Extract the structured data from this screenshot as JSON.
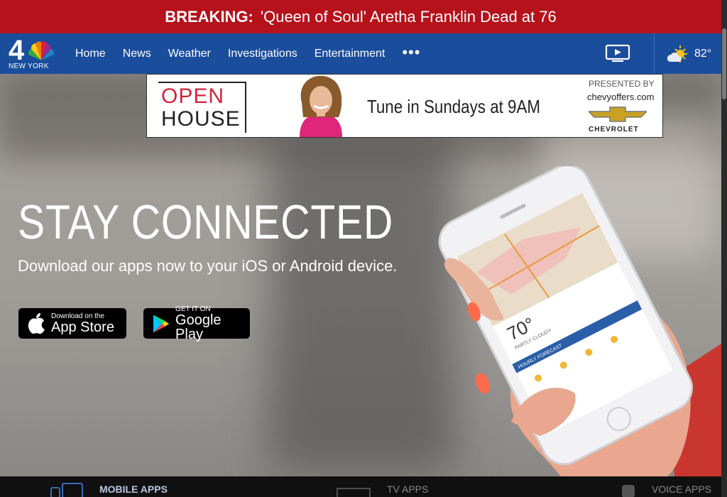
{
  "breaking": {
    "label": "BREAKING:",
    "text": "'Queen of Soul' Aretha Franklin Dead at 76"
  },
  "logo": {
    "channel": "4",
    "city": "NEW YORK"
  },
  "nav": {
    "items": [
      "Home",
      "News",
      "Weather",
      "Investigations",
      "Entertainment"
    ],
    "more": "•••"
  },
  "weather": {
    "temp": "82°"
  },
  "ad": {
    "open": "OPEN",
    "house": "HOUSE",
    "tagline": "Tune in Sundays at 9AM",
    "presented": "PRESENTED BY",
    "sponsor_site": "chevyoffers.com",
    "sponsor": "CHEVROLET"
  },
  "hero": {
    "title": "STAY CONNECTED",
    "subtitle": "Download our apps now to your iOS or Android device."
  },
  "stores": {
    "apple_small": "Download on the",
    "apple_big": "App Store",
    "google_small": "GET IT ON",
    "google_big": "Google Play"
  },
  "phone": {
    "temp": "70°",
    "condition": "PARTLY CLOUDY",
    "hourly": "HOURLY FORECAST"
  },
  "bottom": {
    "mobile": "MOBILE APPS",
    "tv": "TV APPS",
    "voice": "VOICE APPS"
  },
  "colors": {
    "breaking": "#b5121b",
    "nav": "#1a4d9c"
  }
}
